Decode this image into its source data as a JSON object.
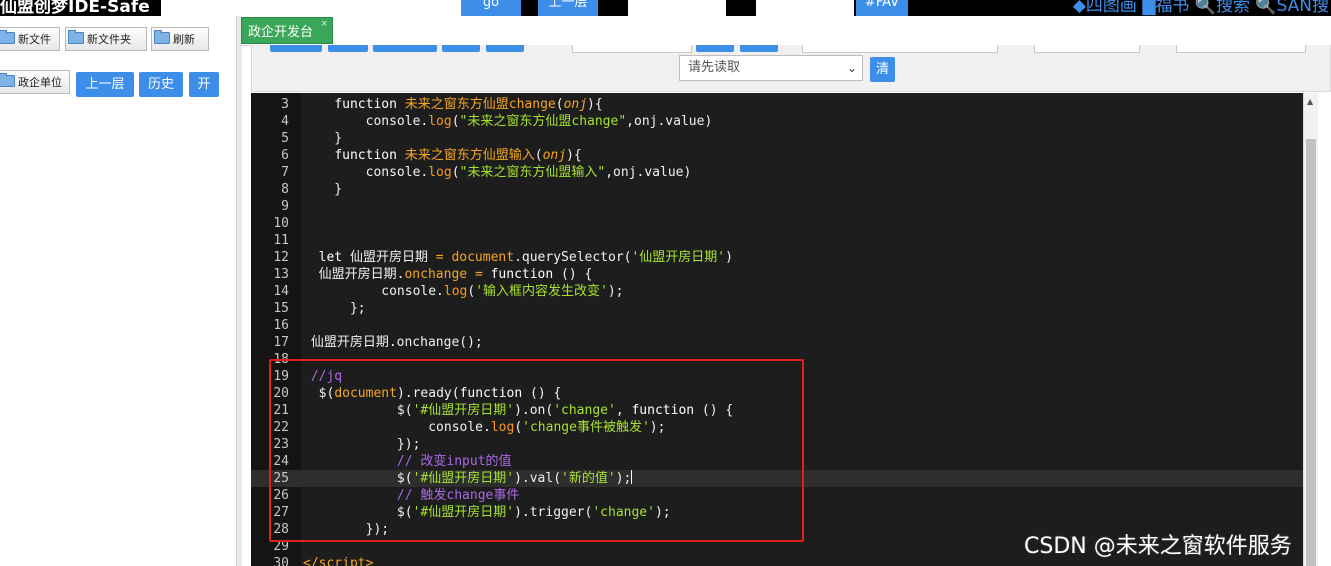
{
  "topbar": {
    "app_title": "仙盟创梦IDE-Safe",
    "go_label": "go",
    "up_label": "上一层",
    "fav_label": "#FAV",
    "right_links": "◆四图画 ▇福书 🔍搜索 🔍SAN搜"
  },
  "file_toolbar": {
    "new_file": "新文件",
    "new_folder": "新文件夹",
    "refresh": "刷新",
    "enterprise": "政企单位",
    "up_level": "上一层",
    "history": "历史",
    "open": "开"
  },
  "tab": {
    "label": "政企开发台",
    "close": "×"
  },
  "editor_toolbar": {
    "select_placeholder": "请先读取",
    "clear_label": "清"
  },
  "code_lines": [
    {
      "n": "3",
      "html": "    <span class='kw'>function</span> <span class='fn'>未来之窗东方仙盟change</span>(<span class='prm'>onj</span>){"
    },
    {
      "n": "4",
      "html": "        console.<span class='meth'>log</span>(<span class='str'>\"未来之窗东方仙盟change\"</span>,onj.value)"
    },
    {
      "n": "5",
      "html": "    }"
    },
    {
      "n": "6",
      "html": "    <span class='kw'>function</span> <span class='fn'>未来之窗东方仙盟输入</span>(<span class='prm'>onj</span>){"
    },
    {
      "n": "7",
      "html": "        console.<span class='meth'>log</span>(<span class='str'>\"未来之窗东方仙盟输入\"</span>,onj.value)"
    },
    {
      "n": "8",
      "html": "    }"
    },
    {
      "n": "9",
      "html": ""
    },
    {
      "n": "10",
      "html": ""
    },
    {
      "n": "11",
      "html": ""
    },
    {
      "n": "12",
      "html": "  <span class='kw'>let</span> 仙盟开房日期 <span class='op'>=</span> <span class='fn'>document</span>.querySelector(<span class='str'>'仙盟开房日期'</span>)"
    },
    {
      "n": "13",
      "html": "  仙盟开房日期.<span class='fn'>onchange</span> <span class='op'>=</span> <span class='kw'>function</span> () {"
    },
    {
      "n": "14",
      "html": "          console.<span class='meth'>log</span>(<span class='str'>'输入框内容发生改变'</span>);"
    },
    {
      "n": "15",
      "html": "      };"
    },
    {
      "n": "16",
      "html": ""
    },
    {
      "n": "17",
      "html": " 仙盟开房日期.onchange();"
    },
    {
      "n": "18",
      "html": ""
    },
    {
      "n": "19",
      "html": " <span class='cm'>//jq</span>"
    },
    {
      "n": "20",
      "html": "  $(<span class='fn'>document</span>).ready(<span class='kw'>function</span> () {"
    },
    {
      "n": "21",
      "html": "            $(<span class='str'>'#仙盟开房日期'</span>).on(<span class='str'>'change'</span>, <span class='kw'>function</span> () {"
    },
    {
      "n": "22",
      "html": "                console.<span class='meth'>log</span>(<span class='str'>'change事件被触发'</span>);"
    },
    {
      "n": "23",
      "html": "            });"
    },
    {
      "n": "24",
      "html": "            <span class='cm'>// 改变input的值</span>"
    },
    {
      "n": "25",
      "html": "            $(<span class='str'>'#仙盟开房日期'</span>).val(<span class='str'>'新的值'</span>);<span class='cursor'></span>"
    },
    {
      "n": "26",
      "html": "            <span class='cm'>// 触发change事件</span>"
    },
    {
      "n": "27",
      "html": "            $(<span class='str'>'#仙盟开房日期'</span>).trigger(<span class='str'>'change'</span>);"
    },
    {
      "n": "28",
      "html": "        });"
    },
    {
      "n": "29",
      "html": ""
    },
    {
      "n": "30",
      "html": "<span class='fn'>&lt;/script&gt;</span>"
    }
  ],
  "active_line": "25",
  "watermark": "CSDN @未来之窗软件服务",
  "colors": {
    "accent": "#3d8ee8",
    "tab_green": "#3aa65a",
    "highlight": "#e0201c",
    "editor_bg": "#1d1d1d"
  }
}
